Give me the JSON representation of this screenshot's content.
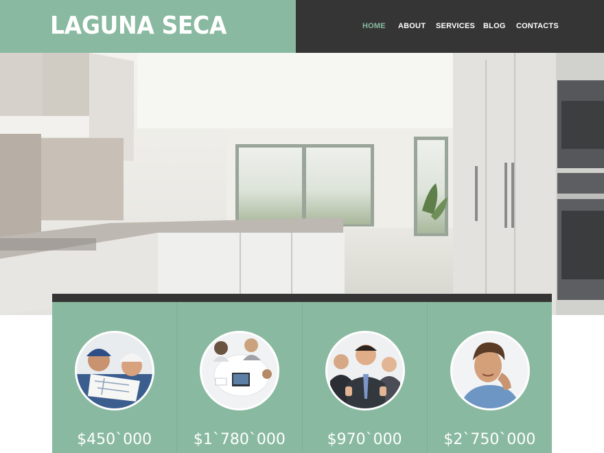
{
  "header": {
    "site_title": "LAGUNA SECA",
    "nav": [
      {
        "label": "HOME",
        "active": true
      },
      {
        "label": "ABOUT",
        "active": false
      },
      {
        "label": "SERVICES",
        "active": false
      },
      {
        "label": "BLOG",
        "active": false
      },
      {
        "label": "CONTACTS",
        "active": false
      }
    ]
  },
  "colors": {
    "accent": "#89b9a0",
    "dark": "#353535",
    "text_light": "#ffffff"
  },
  "listings": [
    {
      "price": "$450`000",
      "photo": "engineers-with-blueprint"
    },
    {
      "price": "$1`780`000",
      "photo": "business-meeting-overhead"
    },
    {
      "price": "$970`000",
      "photo": "team-thumbs-up"
    },
    {
      "price": "$2`750`000",
      "photo": "smiling-man-portrait"
    }
  ]
}
